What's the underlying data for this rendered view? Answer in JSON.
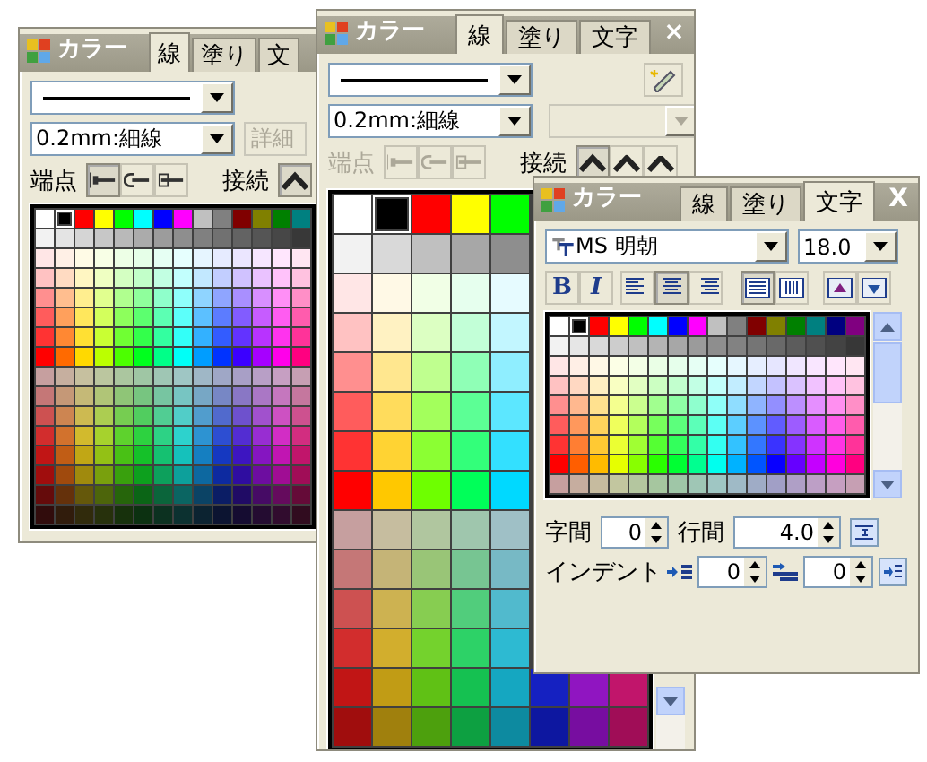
{
  "back_window": {
    "title": "カラー",
    "tabs": [
      {
        "label": "線",
        "selected": true
      },
      {
        "label": "塗り",
        "selected": false
      },
      {
        "label": "文",
        "selected": false
      }
    ],
    "width_select": "0.2mm:細線",
    "detail_field": {
      "label": "詳細",
      "disabled": true
    },
    "endpoint_label": "端点",
    "endpoint_disabled": false,
    "endpoints": [
      {
        "selected": true
      },
      {
        "selected": false
      },
      {
        "selected": false
      }
    ],
    "join_label": "接続",
    "joins": [
      {
        "selected": true
      }
    ],
    "swatches": [
      {
        "color": "#ffffff",
        "selected": false
      },
      {
        "color": "#000000",
        "selected": true
      },
      {
        "color": "#ff0000",
        "selected": false
      },
      {
        "color": "#ffff00",
        "selected": false
      },
      {
        "color": "#00ff00",
        "selected": false
      },
      {
        "color": "#00ffff",
        "selected": false
      },
      {
        "color": "#0000ff",
        "selected": false
      },
      {
        "color": "#ff00ff",
        "selected": false
      },
      {
        "color": "#c0c0c0",
        "selected": false
      },
      {
        "color": "#808080",
        "selected": false
      },
      {
        "color": "#800000",
        "selected": false
      },
      {
        "color": "#808000",
        "selected": false
      },
      {
        "color": "#008000",
        "selected": false
      },
      {
        "color": "#008080",
        "selected": false
      }
    ]
  },
  "line_window": {
    "title": "カラー",
    "tabs": [
      {
        "label": "線",
        "selected": true
      },
      {
        "label": "塗り",
        "selected": false
      },
      {
        "label": "文字",
        "selected": false
      }
    ],
    "close": "×",
    "width_select": "0.2mm:細線",
    "style_select_disabled": true,
    "endpoint_label": "端点",
    "endpoint_disabled": true,
    "endpoints": [
      {
        "selected": false
      },
      {
        "selected": false
      },
      {
        "selected": false
      }
    ],
    "join_label": "接続",
    "joins": [
      {
        "selected": true
      },
      {
        "selected": false
      },
      {
        "selected": false
      }
    ],
    "swatches": [
      {
        "color": "#ffffff",
        "selected": false
      },
      {
        "color": "#000000",
        "selected": true
      },
      {
        "color": "#ff0000",
        "selected": false
      },
      {
        "color": "#ffff00",
        "selected": false
      },
      {
        "color": "#00ff00",
        "selected": false
      }
    ]
  },
  "text_window": {
    "title": "カラー",
    "tabs": [
      {
        "label": "線",
        "selected": false
      },
      {
        "label": "塗り",
        "selected": false
      },
      {
        "label": "文字",
        "selected": true
      }
    ],
    "close": "X",
    "font": "MS 明朝",
    "size": "18.0",
    "styles": [
      {
        "kind": "bold",
        "label": "B",
        "selected": false
      },
      {
        "kind": "italic",
        "label": "I",
        "selected": false
      }
    ],
    "align": [
      {
        "selected": false
      },
      {
        "selected": true
      },
      {
        "selected": false
      }
    ],
    "direction": [
      {
        "selected": true
      },
      {
        "selected": false
      }
    ],
    "swatches": [
      {
        "color": "#ffffff",
        "selected": false
      },
      {
        "color": "#000000",
        "selected": true
      },
      {
        "color": "#ff0000",
        "selected": false
      },
      {
        "color": "#ffff00",
        "selected": false
      },
      {
        "color": "#00ff00",
        "selected": false
      },
      {
        "color": "#00ffff",
        "selected": false
      },
      {
        "color": "#0000ff",
        "selected": false
      },
      {
        "color": "#ff00ff",
        "selected": false
      },
      {
        "color": "#c0c0c0",
        "selected": false
      },
      {
        "color": "#808080",
        "selected": false
      },
      {
        "color": "#800000",
        "selected": false
      },
      {
        "color": "#808000",
        "selected": false
      },
      {
        "color": "#008000",
        "selected": false
      },
      {
        "color": "#008080",
        "selected": false
      },
      {
        "color": "#000080",
        "selected": false
      },
      {
        "color": "#800080",
        "selected": false
      }
    ],
    "char_spacing": {
      "label": "字間",
      "value": "0"
    },
    "line_spacing": {
      "label": "行間",
      "value": "4.0"
    },
    "indent": {
      "label": "インデント",
      "first": "0",
      "hanging": "0"
    }
  }
}
